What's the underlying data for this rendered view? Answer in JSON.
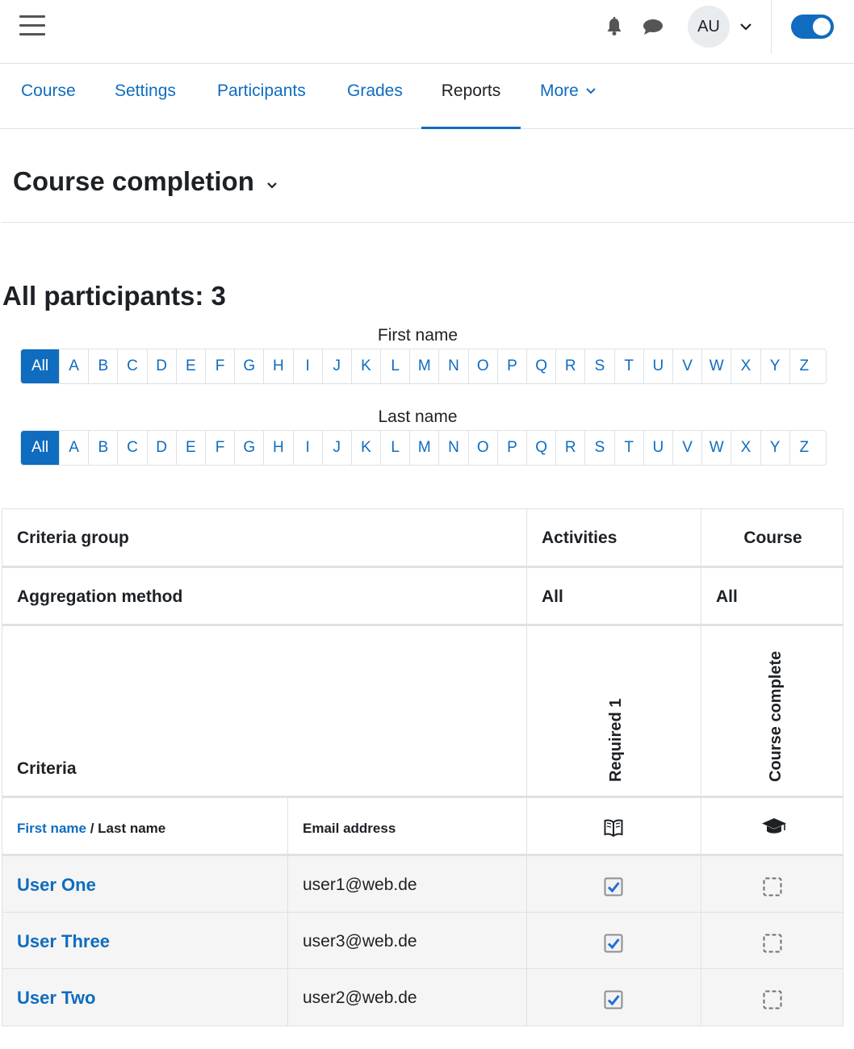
{
  "navbar": {
    "menu_icon": "hamburger-icon",
    "notifications_icon": "bell-icon",
    "messages_icon": "chat-bubble-icon",
    "avatar_initials": "AU",
    "user_menu_icon": "chevron-down-icon",
    "edit_mode_toggle": "on",
    "accent_color": "#0f6cbf"
  },
  "secondary_nav": {
    "items": [
      {
        "label": "Course"
      },
      {
        "label": "Settings"
      },
      {
        "label": "Participants"
      },
      {
        "label": "Grades"
      },
      {
        "label": "Reports",
        "active": true
      },
      {
        "label": "More",
        "icon": "chevron-down-icon"
      }
    ]
  },
  "page": {
    "title": "Course completion",
    "title_icon": "chevron-down-icon",
    "participants_heading": "All participants: 3"
  },
  "initials_bars": {
    "first_name_label": "First name",
    "last_name_label": "Last name",
    "letters": [
      "All",
      "A",
      "B",
      "C",
      "D",
      "E",
      "F",
      "G",
      "H",
      "I",
      "J",
      "K",
      "L",
      "M",
      "N",
      "O",
      "P",
      "Q",
      "R",
      "S",
      "T",
      "U",
      "V",
      "W",
      "X",
      "Y",
      "Z"
    ],
    "selected": "All"
  },
  "table": {
    "criteria_group_label": "Criteria group",
    "activities_label": "Activities",
    "course_label": "Course",
    "aggregation_label": "Aggregation method",
    "aggregation_activities": "All",
    "aggregation_course": "All",
    "criteria_label": "Criteria",
    "criteria_required": "Required 1",
    "criteria_course_complete": "Course complete",
    "col_first_name": "First name",
    "col_separator": " / ",
    "col_last_name": "Last name",
    "col_email": "Email address",
    "activity_icon": "book-icon",
    "course_icon": "graduation-cap-icon",
    "rows": [
      {
        "name": "User One",
        "email": "user1@web.de",
        "required_complete": true,
        "course_complete": false
      },
      {
        "name": "User Three",
        "email": "user3@web.de",
        "required_complete": true,
        "course_complete": false
      },
      {
        "name": "User Two",
        "email": "user2@web.de",
        "required_complete": true,
        "course_complete": false
      }
    ]
  }
}
